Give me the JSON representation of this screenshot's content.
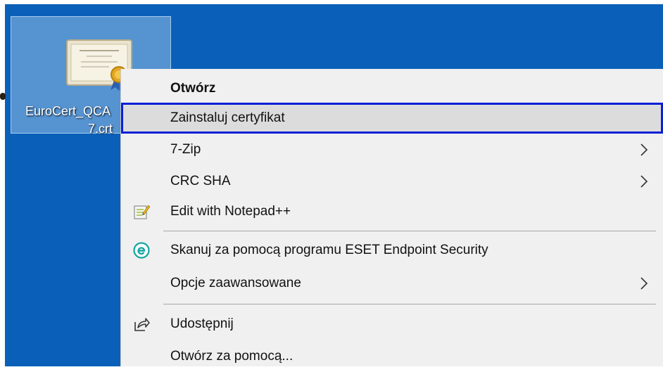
{
  "desktop": {
    "file_label_line1": "EuroCert_QCA",
    "file_label_line2": "7.crt",
    "file_icon": "certificate-icon"
  },
  "context_menu": {
    "items": [
      {
        "label": "Otwórz",
        "bold": true
      },
      {
        "label": "Zainstaluj certyfikat",
        "highlighted": true
      },
      {
        "label": "7-Zip",
        "submenu": true
      },
      {
        "label": "CRC SHA",
        "submenu": true
      },
      {
        "label": "Edit with Notepad++",
        "icon": "notepad-plus-plus-icon"
      },
      {
        "label": "Skanuj za pomocą programu ESET Endpoint Security",
        "icon": "eset-icon"
      },
      {
        "label": "Opcje zaawansowane",
        "submenu": true
      },
      {
        "label": "Udostępnij",
        "icon": "share-icon"
      },
      {
        "label": "Otwórz za pomocą..."
      }
    ]
  },
  "colors": {
    "desktop_background": "#0a60b8",
    "menu_background": "#f0f0f0",
    "highlight_border": "#0a1fd6",
    "eset_accent": "#17a6a0"
  }
}
